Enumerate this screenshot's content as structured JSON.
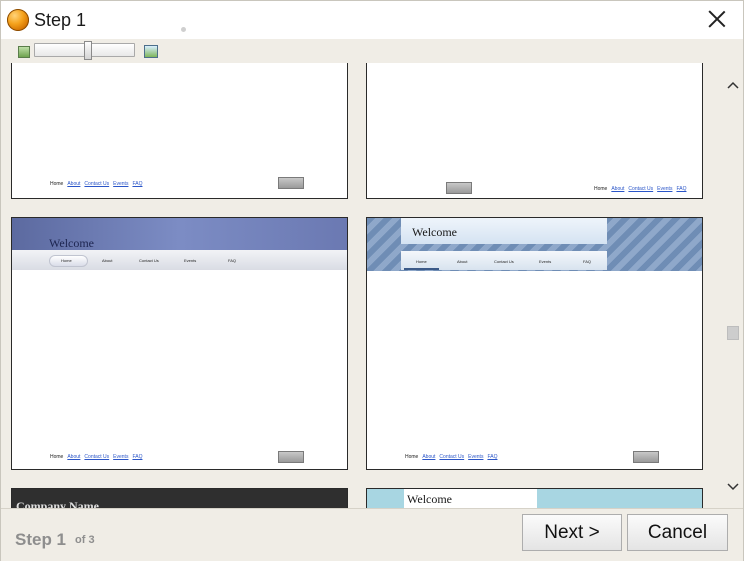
{
  "window": {
    "title": "Step 1"
  },
  "toolbar": {
    "zoom_icon_small": "image-small-icon",
    "zoom_icon_large": "image-large-icon"
  },
  "templates": {
    "row1_left": {
      "links": [
        "Home",
        "About",
        "Contact Us",
        "Events",
        "FAQ"
      ]
    },
    "row1_right": {
      "links": [
        "Home",
        "About",
        "Contact Us",
        "Events",
        "FAQ"
      ]
    },
    "row2_left": {
      "welcome": "Welcome",
      "nav": [
        "Home",
        "About",
        "Contact Us",
        "Events",
        "FAQ"
      ],
      "links": [
        "Home",
        "About",
        "Contact Us",
        "Events",
        "FAQ"
      ]
    },
    "row2_right": {
      "welcome": "Welcome",
      "nav": [
        "Home",
        "About",
        "Contact Us",
        "Events",
        "FAQ"
      ],
      "links": [
        "Home",
        "About",
        "Contact Us",
        "Events",
        "FAQ"
      ]
    },
    "row3_left": {
      "company": "Company Name"
    },
    "row3_right": {
      "welcome": "Welcome"
    }
  },
  "footer": {
    "step_text": "Step 1",
    "of_text": "of 3",
    "next_label": "Next >",
    "cancel_label": "Cancel"
  }
}
